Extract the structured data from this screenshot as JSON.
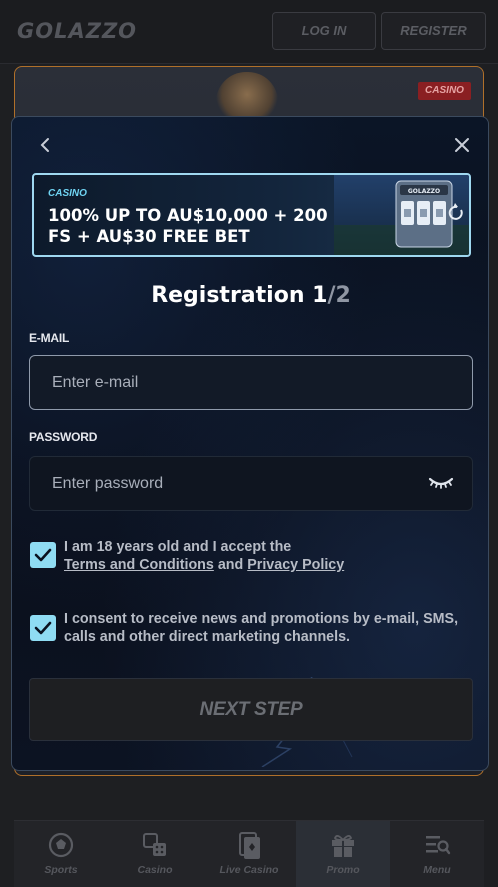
{
  "header": {
    "logo": "GOLAZZO",
    "login_label": "LOG IN",
    "register_label": "REGISTER"
  },
  "background": {
    "casino_tag": "CASINO"
  },
  "modal": {
    "back_icon": "chevron-left-icon",
    "close_icon": "close-icon",
    "promo": {
      "category": "CASINO",
      "text": "100% UP TO AU$10,000 + 200 FS + AU$30 FREE BET",
      "art_logo": "GOLAZZO"
    },
    "title_main": "Registration 1",
    "title_sep": "/",
    "title_total": "2",
    "email": {
      "label": "E-MAIL",
      "placeholder": "Enter e-mail",
      "value": ""
    },
    "password": {
      "label": "PASSWORD",
      "placeholder": "Enter password",
      "value": ""
    },
    "terms": {
      "checked": true,
      "prefix": "I am 18 years old and I accept the ",
      "terms_link": "Terms and Conditions",
      "and": " and ",
      "privacy_link": "Privacy Policy"
    },
    "consent": {
      "checked": true,
      "text": "I consent to receive news and promotions by e-mail, SMS, calls and other direct marketing channels."
    },
    "next_label": "NEXT STEP"
  },
  "bottom_nav": {
    "items": [
      {
        "label": "Sports",
        "icon": "soccer-ball-icon"
      },
      {
        "label": "Casino",
        "icon": "dice-icon"
      },
      {
        "label": "Live Casino",
        "icon": "cards-icon"
      },
      {
        "label": "Promo",
        "icon": "gift-icon"
      },
      {
        "label": "Menu",
        "icon": "menu-search-icon"
      }
    ],
    "active": "Promo"
  },
  "colors": {
    "accent": "#8fdcf3",
    "modal_bg": "#0a0f1b",
    "page_bg": "#1e1f22"
  }
}
